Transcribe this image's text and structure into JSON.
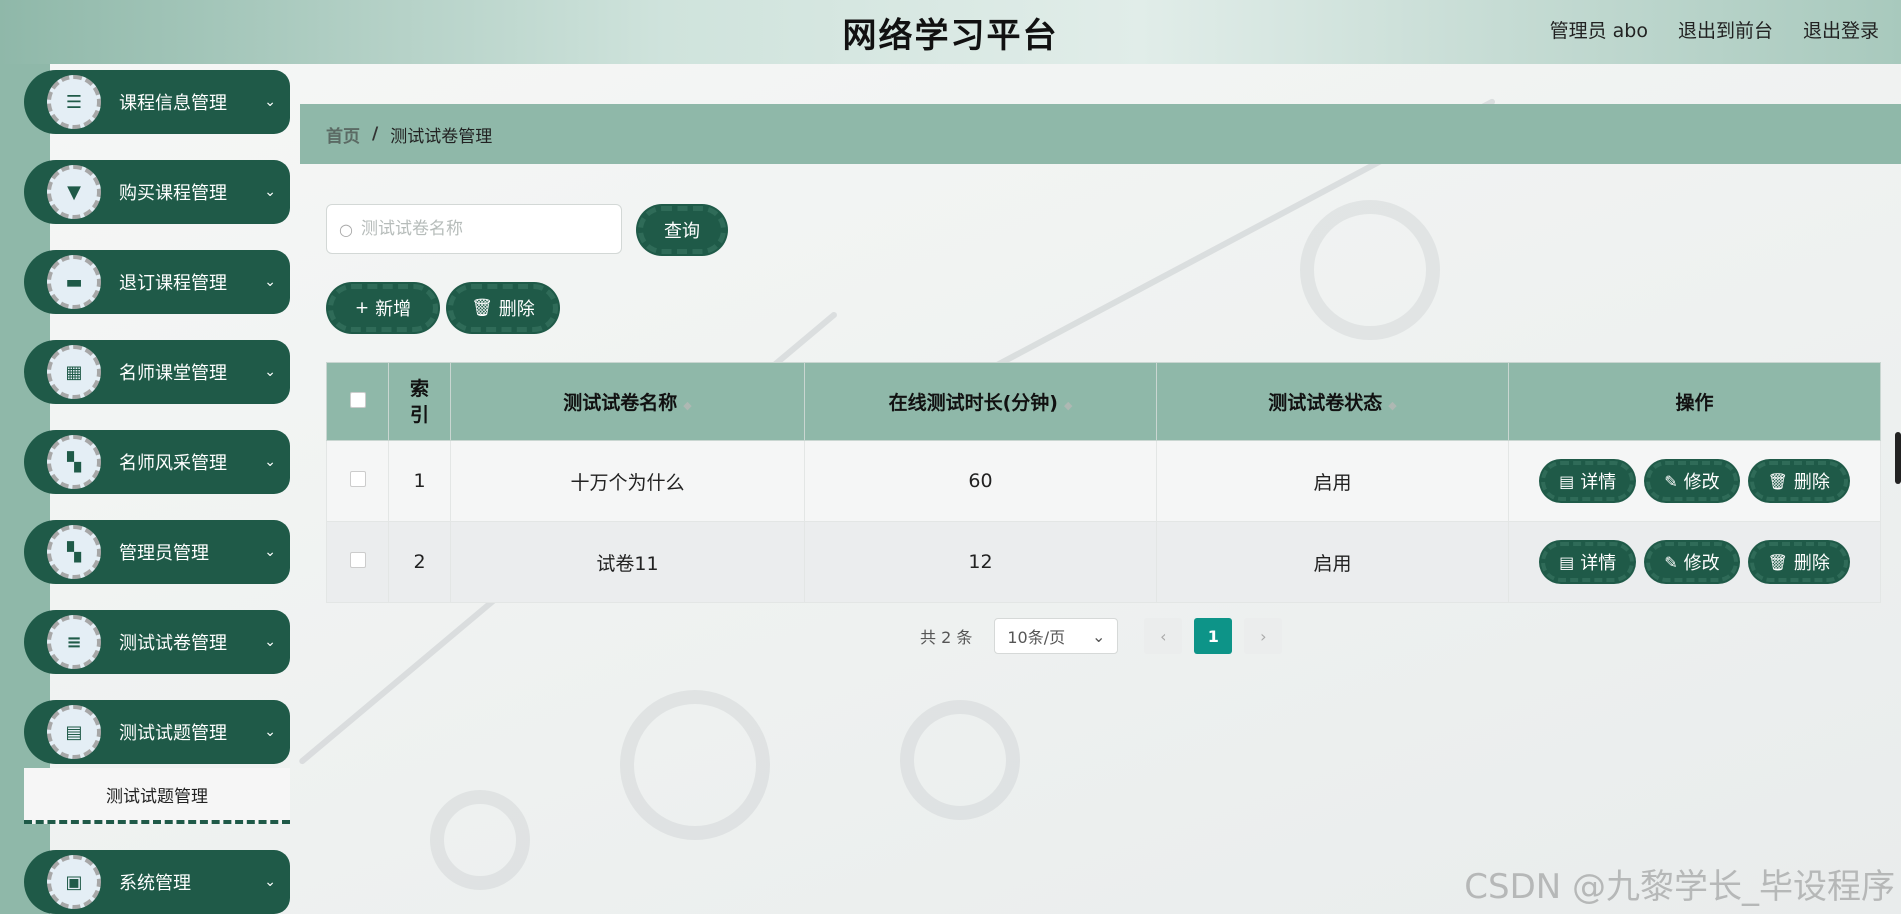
{
  "header": {
    "title": "网络学习平台",
    "admin_label": "管理员 abo",
    "exit_front": "退出到前台",
    "logout": "退出登录"
  },
  "sidebar": {
    "items": [
      {
        "label": "课程信息管理",
        "icon": "list-icon"
      },
      {
        "label": "购买课程管理",
        "icon": "pin-icon"
      },
      {
        "label": "退订课程管理",
        "icon": "briefcase-icon"
      },
      {
        "label": "名师课堂管理",
        "icon": "grid-icon"
      },
      {
        "label": "名师风采管理",
        "icon": "apps-icon"
      },
      {
        "label": "管理员管理",
        "icon": "apps-icon"
      },
      {
        "label": "测试试卷管理",
        "icon": "menu-icon"
      },
      {
        "label": "测试试题管理",
        "icon": "clipboard-icon"
      },
      {
        "label": "系统管理",
        "icon": "chat-icon"
      }
    ],
    "submenu_label": "测试试题管理"
  },
  "breadcrumb": {
    "home": "首页",
    "separator": "/",
    "current": "测试试卷管理"
  },
  "search": {
    "placeholder": "测试试卷名称",
    "query_label": "查询"
  },
  "toolbar": {
    "add_label": "新增",
    "delete_label": "删除"
  },
  "table": {
    "headers": {
      "index": "索引",
      "name": "测试试卷名称",
      "duration": "在线测试时长(分钟)",
      "status": "测试试卷状态",
      "ops": "操作"
    },
    "rows": [
      {
        "index": "1",
        "name": "十万个为什么",
        "duration": "60",
        "status": "启用"
      },
      {
        "index": "2",
        "name": "试卷11",
        "duration": "12",
        "status": "启用"
      }
    ],
    "op_labels": {
      "detail": "详情",
      "edit": "修改",
      "delete": "删除"
    }
  },
  "pager": {
    "total": "共 2 条",
    "page_size": "10条/页",
    "current_page": "1"
  },
  "watermark": "CSDN @九黎学长_毕设程序",
  "colors": {
    "accent": "#1f5a48",
    "header_green": "#8fb8a9",
    "page_active": "#0d9488"
  }
}
